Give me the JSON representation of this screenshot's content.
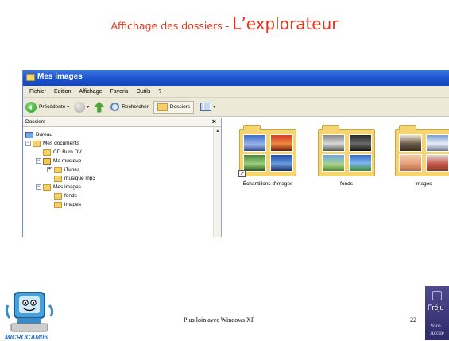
{
  "slide": {
    "title_prefix": "Affichage des dossiers - ",
    "title_main": "L’explorateur",
    "footer_text": "Plus loin avec Windows XP",
    "page_number": "22",
    "logo_text": "MICROCAM06",
    "badge_text": "Fréju",
    "badge_subtext_1": "Vous",
    "badge_subtext_2": "Accue"
  },
  "window": {
    "title": "Mes images",
    "menu": [
      "Fichier",
      "Edition",
      "Affichage",
      "Favoris",
      "Outils",
      "?"
    ],
    "toolbar": {
      "back_label": "Précédente",
      "search_label": "Rechercher",
      "folders_label": "Dossiers"
    },
    "tree": {
      "header": "Dossiers",
      "close_glyph": "×",
      "items": [
        {
          "label": "Bureau"
        },
        {
          "label": "Mes documents"
        },
        {
          "label": "CD Burn DV"
        },
        {
          "label": "Ma musique"
        },
        {
          "label": "iTunes"
        },
        {
          "label": "musique mp3"
        },
        {
          "label": "Mes images"
        },
        {
          "label": "fonds"
        },
        {
          "label": "images"
        }
      ]
    },
    "folders": [
      {
        "label": "Échantillons d'images"
      },
      {
        "label": "fonds"
      },
      {
        "label": "images"
      }
    ]
  }
}
